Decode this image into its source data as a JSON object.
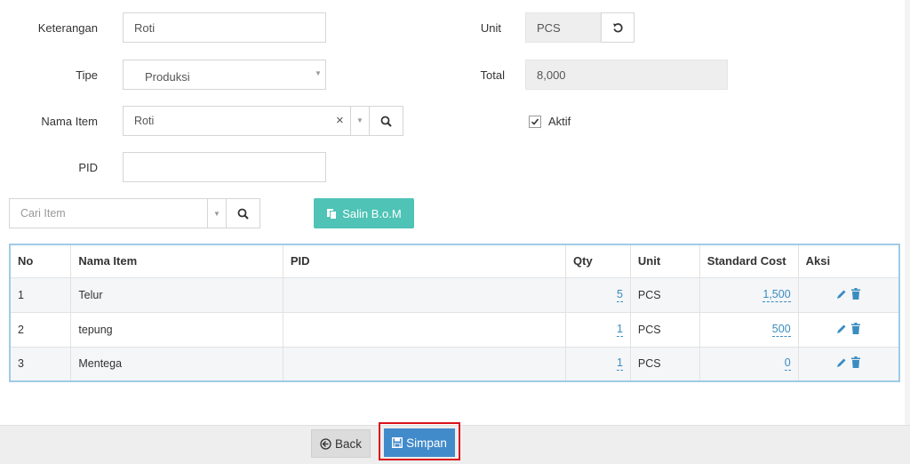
{
  "form": {
    "keterangan": {
      "label": "Keterangan",
      "value": "Roti"
    },
    "tipe": {
      "label": "Tipe",
      "value": "Produksi"
    },
    "nama_item": {
      "label": "Nama Item",
      "value": "Roti",
      "clear": "×"
    },
    "pid": {
      "label": "PID",
      "value": ""
    },
    "unit": {
      "label": "Unit",
      "value": "PCS"
    },
    "total": {
      "label": "Total",
      "value": "8,000"
    },
    "aktif": {
      "label": "Aktif",
      "checked": true
    }
  },
  "toolbar": {
    "cari_item_placeholder": "Cari Item",
    "salin_bom_label": "Salin B.o.M"
  },
  "table": {
    "headers": [
      "No",
      "Nama Item",
      "PID",
      "Qty",
      "Unit",
      "Standard Cost",
      "Aksi"
    ],
    "rows": [
      {
        "no": "1",
        "nama_item": "Telur",
        "pid": "",
        "qty": "5",
        "unit": "PCS",
        "standard_cost": "1,500"
      },
      {
        "no": "2",
        "nama_item": "tepung",
        "pid": "",
        "qty": "1",
        "unit": "PCS",
        "standard_cost": "500"
      },
      {
        "no": "3",
        "nama_item": "Mentega",
        "pid": "",
        "qty": "1",
        "unit": "PCS",
        "standard_cost": "0"
      }
    ]
  },
  "footer": {
    "back_label": "Back",
    "save_label": "Simpan"
  },
  "colors": {
    "accent_blue": "#428bca",
    "teal": "#4ec3b6",
    "highlight_red": "#d9121b",
    "link_blue": "#3a8cc1"
  },
  "icons": [
    "refresh-icon",
    "search-icon",
    "copy-icon",
    "edit-icon",
    "trash-icon",
    "back-arrow-icon",
    "save-icon",
    "checkbox-checked-icon"
  ]
}
